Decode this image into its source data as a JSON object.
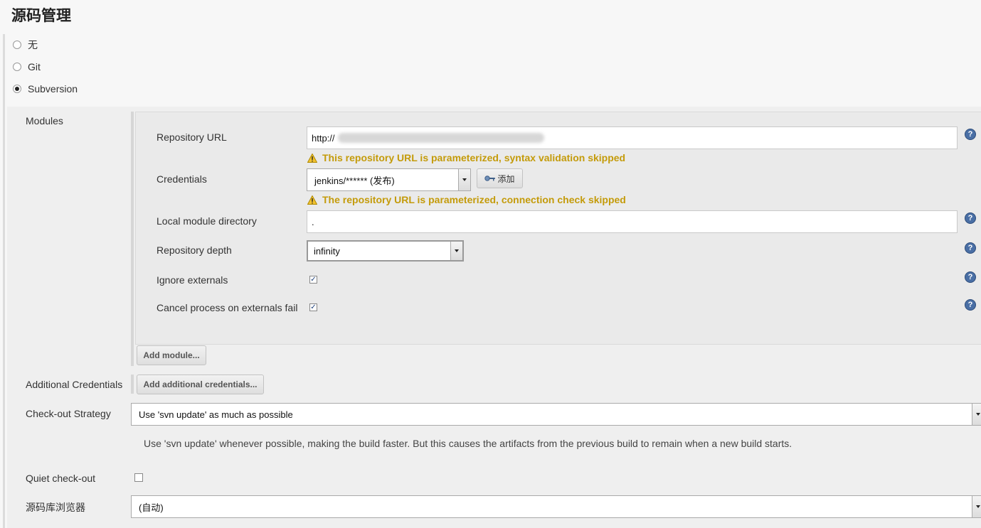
{
  "section_title": "源码管理",
  "scm_options": [
    {
      "label": "无",
      "checked": false
    },
    {
      "label": "Git",
      "checked": false
    },
    {
      "label": "Subversion",
      "checked": true
    }
  ],
  "modules": {
    "label": "Modules",
    "repository_url": {
      "label": "Repository URL",
      "value": "http://",
      "warning": "This repository URL is parameterized, syntax validation skipped"
    },
    "credentials": {
      "label": "Credentials",
      "value": "jenkins/****** (发布)",
      "add_label": "添加",
      "warning": "The repository URL is parameterized, connection check skipped"
    },
    "local_module_directory": {
      "label": "Local module directory",
      "value": "."
    },
    "repository_depth": {
      "label": "Repository depth",
      "value": "infinity"
    },
    "ignore_externals": {
      "label": "Ignore externals",
      "checked": true
    },
    "cancel_on_externals_fail": {
      "label": "Cancel process on externals fail",
      "checked": true
    },
    "add_module_label": "Add module..."
  },
  "additional_credentials": {
    "label": "Additional Credentials",
    "button_label": "Add additional credentials..."
  },
  "checkout_strategy": {
    "label": "Check-out Strategy",
    "value": "Use 'svn update' as much as possible",
    "description": "Use 'svn update' whenever possible, making the build faster. But this causes the artifacts from the previous build to remain when a new build starts."
  },
  "quiet_checkout": {
    "label": "Quiet check-out",
    "checked": false
  },
  "repo_browser": {
    "label": "源码库浏览器",
    "value": "(自动)"
  },
  "colors": {
    "warning": "#c49b0a",
    "help": "#4a6fa5"
  }
}
